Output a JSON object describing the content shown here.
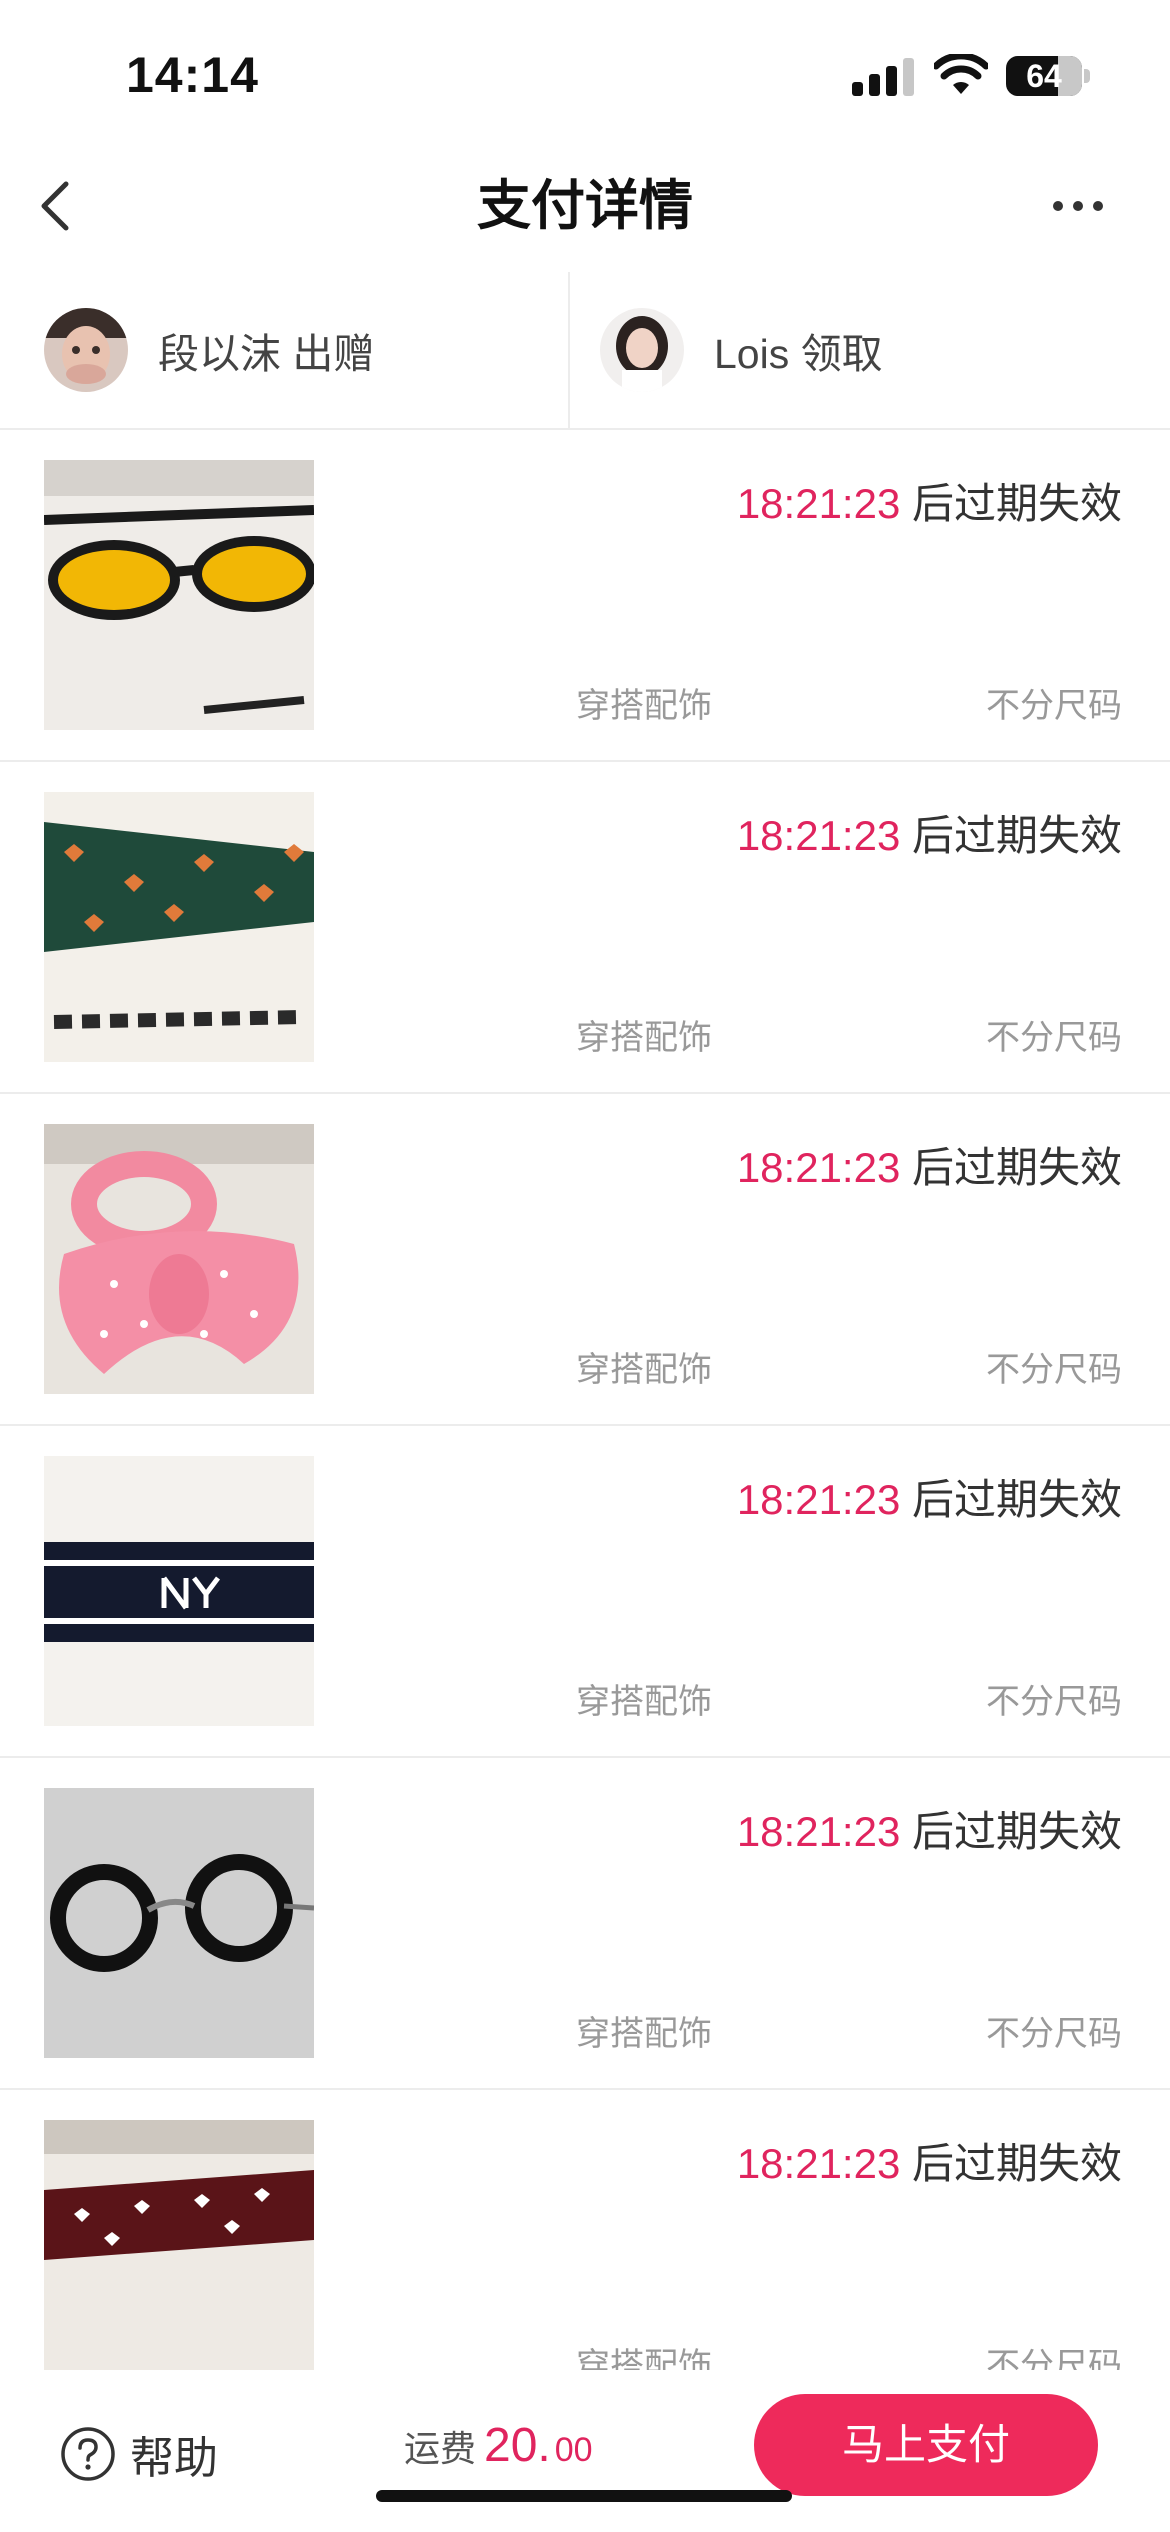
{
  "status_bar": {
    "time": "14:14",
    "battery": "64"
  },
  "nav": {
    "title": "支付详情"
  },
  "parties": {
    "giver": {
      "name": "段以沫 出赠"
    },
    "receiver": {
      "name": "Lois 领取"
    }
  },
  "items": [
    {
      "image": "yellow-tinted-sunglasses",
      "countdown": "18:21:23",
      "expiry_text": " 后过期失效",
      "category": "穿搭配饰",
      "size": "不分尺码"
    },
    {
      "image": "green-heart-print-scarf",
      "countdown": "18:21:23",
      "expiry_text": " 后过期失效",
      "category": "穿搭配饰",
      "size": "不分尺码"
    },
    {
      "image": "pink-polka-dot-bow-headband",
      "countdown": "18:21:23",
      "expiry_text": " 后过期失效",
      "category": "穿搭配饰",
      "size": "不分尺码"
    },
    {
      "image": "navy-ny-headband",
      "countdown": "18:21:23",
      "expiry_text": " 后过期失效",
      "category": "穿搭配饰",
      "size": "不分尺码"
    },
    {
      "image": "round-black-glasses",
      "countdown": "18:21:23",
      "expiry_text": " 后过期失效",
      "category": "穿搭配饰",
      "size": "不分尺码"
    },
    {
      "image": "burgundy-heart-print-scarf",
      "countdown": "18:21:23",
      "expiry_text": " 后过期失效",
      "category": "穿搭配饰",
      "size": "不分尺码"
    }
  ],
  "bottom": {
    "help_label": "帮助",
    "shipping_label": "运费",
    "shipping_int": "20.",
    "shipping_dec": "00",
    "pay_label": "马上支付"
  },
  "colors": {
    "accent": "#e0245e",
    "button": "#ee2a5b"
  }
}
